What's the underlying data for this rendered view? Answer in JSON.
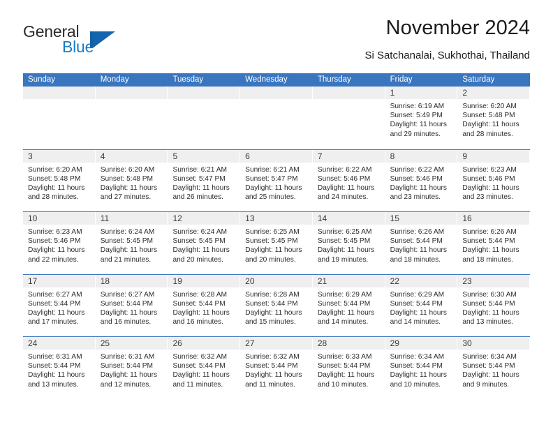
{
  "brand": {
    "name_part1": "General",
    "name_part2": "Blue",
    "logo_icon": "flag-triangle-icon",
    "accent_color": "#1b7bc4"
  },
  "header": {
    "title": "November 2024",
    "location": "Si Satchanalai, Sukhothai, Thailand"
  },
  "theme": {
    "header_bar_color": "#3a76bf",
    "daynum_band_color": "#efefef",
    "row_divider_color": "#3a76bf",
    "text_color": "#2c2c2c"
  },
  "calendar": {
    "weekday_headers": [
      "Sunday",
      "Monday",
      "Tuesday",
      "Wednesday",
      "Thursday",
      "Friday",
      "Saturday"
    ],
    "weeks": [
      [
        {
          "day": "",
          "info": "",
          "empty": true
        },
        {
          "day": "",
          "info": "",
          "empty": true
        },
        {
          "day": "",
          "info": "",
          "empty": true
        },
        {
          "day": "",
          "info": "",
          "empty": true
        },
        {
          "day": "",
          "info": "",
          "empty": true
        },
        {
          "day": "1",
          "info": "Sunrise: 6:19 AM\nSunset: 5:49 PM\nDaylight: 11 hours and 29 minutes.",
          "empty": false
        },
        {
          "day": "2",
          "info": "Sunrise: 6:20 AM\nSunset: 5:48 PM\nDaylight: 11 hours and 28 minutes.",
          "empty": false
        }
      ],
      [
        {
          "day": "3",
          "info": "Sunrise: 6:20 AM\nSunset: 5:48 PM\nDaylight: 11 hours and 28 minutes.",
          "empty": false
        },
        {
          "day": "4",
          "info": "Sunrise: 6:20 AM\nSunset: 5:48 PM\nDaylight: 11 hours and 27 minutes.",
          "empty": false
        },
        {
          "day": "5",
          "info": "Sunrise: 6:21 AM\nSunset: 5:47 PM\nDaylight: 11 hours and 26 minutes.",
          "empty": false
        },
        {
          "day": "6",
          "info": "Sunrise: 6:21 AM\nSunset: 5:47 PM\nDaylight: 11 hours and 25 minutes.",
          "empty": false
        },
        {
          "day": "7",
          "info": "Sunrise: 6:22 AM\nSunset: 5:46 PM\nDaylight: 11 hours and 24 minutes.",
          "empty": false
        },
        {
          "day": "8",
          "info": "Sunrise: 6:22 AM\nSunset: 5:46 PM\nDaylight: 11 hours and 23 minutes.",
          "empty": false
        },
        {
          "day": "9",
          "info": "Sunrise: 6:23 AM\nSunset: 5:46 PM\nDaylight: 11 hours and 23 minutes.",
          "empty": false
        }
      ],
      [
        {
          "day": "10",
          "info": "Sunrise: 6:23 AM\nSunset: 5:46 PM\nDaylight: 11 hours and 22 minutes.",
          "empty": false
        },
        {
          "day": "11",
          "info": "Sunrise: 6:24 AM\nSunset: 5:45 PM\nDaylight: 11 hours and 21 minutes.",
          "empty": false
        },
        {
          "day": "12",
          "info": "Sunrise: 6:24 AM\nSunset: 5:45 PM\nDaylight: 11 hours and 20 minutes.",
          "empty": false
        },
        {
          "day": "13",
          "info": "Sunrise: 6:25 AM\nSunset: 5:45 PM\nDaylight: 11 hours and 20 minutes.",
          "empty": false
        },
        {
          "day": "14",
          "info": "Sunrise: 6:25 AM\nSunset: 5:45 PM\nDaylight: 11 hours and 19 minutes.",
          "empty": false
        },
        {
          "day": "15",
          "info": "Sunrise: 6:26 AM\nSunset: 5:44 PM\nDaylight: 11 hours and 18 minutes.",
          "empty": false
        },
        {
          "day": "16",
          "info": "Sunrise: 6:26 AM\nSunset: 5:44 PM\nDaylight: 11 hours and 18 minutes.",
          "empty": false
        }
      ],
      [
        {
          "day": "17",
          "info": "Sunrise: 6:27 AM\nSunset: 5:44 PM\nDaylight: 11 hours and 17 minutes.",
          "empty": false
        },
        {
          "day": "18",
          "info": "Sunrise: 6:27 AM\nSunset: 5:44 PM\nDaylight: 11 hours and 16 minutes.",
          "empty": false
        },
        {
          "day": "19",
          "info": "Sunrise: 6:28 AM\nSunset: 5:44 PM\nDaylight: 11 hours and 16 minutes.",
          "empty": false
        },
        {
          "day": "20",
          "info": "Sunrise: 6:28 AM\nSunset: 5:44 PM\nDaylight: 11 hours and 15 minutes.",
          "empty": false
        },
        {
          "day": "21",
          "info": "Sunrise: 6:29 AM\nSunset: 5:44 PM\nDaylight: 11 hours and 14 minutes.",
          "empty": false
        },
        {
          "day": "22",
          "info": "Sunrise: 6:29 AM\nSunset: 5:44 PM\nDaylight: 11 hours and 14 minutes.",
          "empty": false
        },
        {
          "day": "23",
          "info": "Sunrise: 6:30 AM\nSunset: 5:44 PM\nDaylight: 11 hours and 13 minutes.",
          "empty": false
        }
      ],
      [
        {
          "day": "24",
          "info": "Sunrise: 6:31 AM\nSunset: 5:44 PM\nDaylight: 11 hours and 13 minutes.",
          "empty": false
        },
        {
          "day": "25",
          "info": "Sunrise: 6:31 AM\nSunset: 5:44 PM\nDaylight: 11 hours and 12 minutes.",
          "empty": false
        },
        {
          "day": "26",
          "info": "Sunrise: 6:32 AM\nSunset: 5:44 PM\nDaylight: 11 hours and 11 minutes.",
          "empty": false
        },
        {
          "day": "27",
          "info": "Sunrise: 6:32 AM\nSunset: 5:44 PM\nDaylight: 11 hours and 11 minutes.",
          "empty": false
        },
        {
          "day": "28",
          "info": "Sunrise: 6:33 AM\nSunset: 5:44 PM\nDaylight: 11 hours and 10 minutes.",
          "empty": false
        },
        {
          "day": "29",
          "info": "Sunrise: 6:34 AM\nSunset: 5:44 PM\nDaylight: 11 hours and 10 minutes.",
          "empty": false
        },
        {
          "day": "30",
          "info": "Sunrise: 6:34 AM\nSunset: 5:44 PM\nDaylight: 11 hours and 9 minutes.",
          "empty": false
        }
      ]
    ]
  }
}
